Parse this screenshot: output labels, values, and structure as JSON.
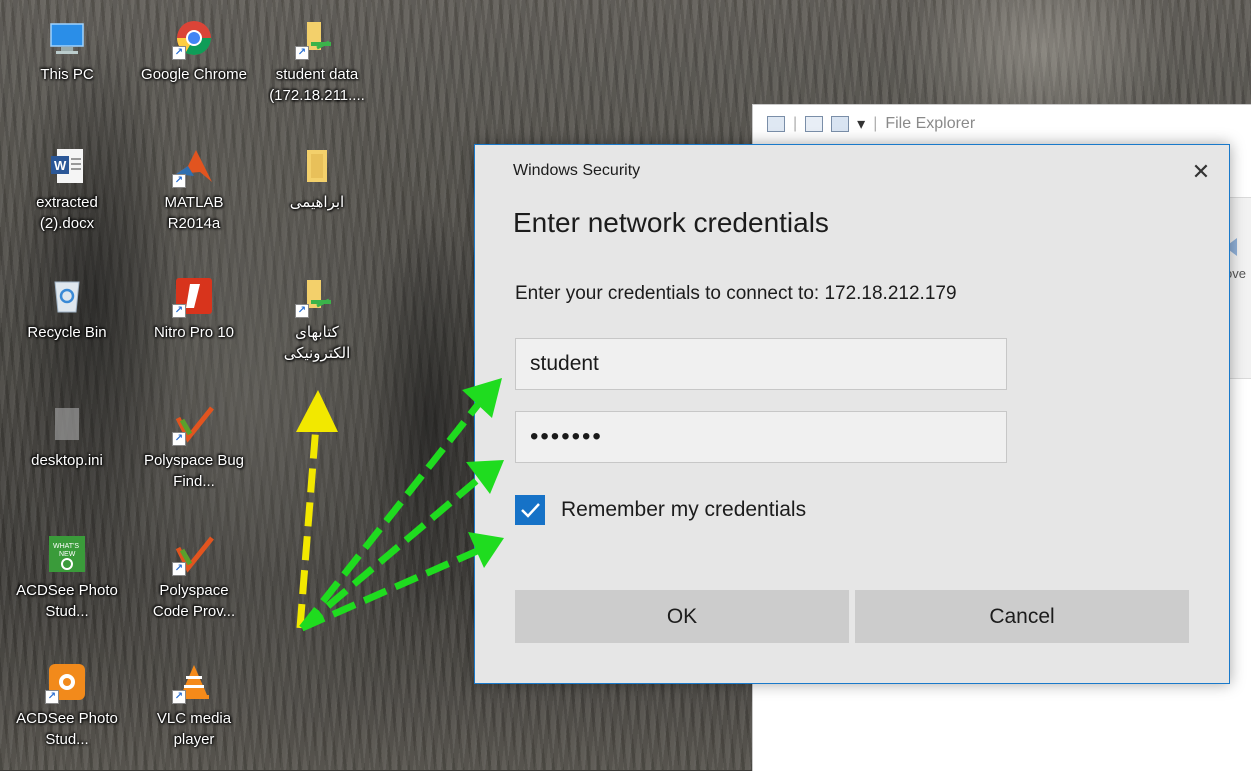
{
  "desktop": {
    "icons": [
      {
        "label": "This PC",
        "icon": "computer-icon"
      },
      {
        "label": "Google Chrome",
        "icon": "chrome-icon"
      },
      {
        "label": "student data (172.18.211....",
        "icon": "network-folder-icon"
      },
      {
        "label": "extracted (2).docx",
        "icon": "word-document-icon"
      },
      {
        "label": "MATLAB R2014a",
        "icon": "matlab-icon"
      },
      {
        "label": "ابراهیمی",
        "icon": "folder-icon"
      },
      {
        "label": "Recycle Bin",
        "icon": "recycle-bin-icon"
      },
      {
        "label": "Nitro Pro 10",
        "icon": "nitro-icon"
      },
      {
        "label": "کتابهای الکترونیکی",
        "icon": "network-folder-icon"
      },
      {
        "label": "desktop.ini",
        "icon": "ini-file-icon"
      },
      {
        "label": "Polyspace Bug Find...",
        "icon": "polyspace-icon"
      },
      {
        "label": "ACDSee Photo Stud...",
        "icon": "acdsee-whats-new-icon"
      },
      {
        "label": "Polyspace Code Prov...",
        "icon": "polyspace-icon"
      },
      {
        "label": "ACDSee Photo Stud...",
        "icon": "acdsee-icon"
      },
      {
        "label": "VLC media player",
        "icon": "vlc-icon"
      }
    ]
  },
  "explorer": {
    "title": "File Explorer",
    "ribbon_fragment": "ove"
  },
  "dialog": {
    "window_title": "Windows Security",
    "heading": "Enter network credentials",
    "prompt": "Enter your credentials to connect to: 172.18.212.179",
    "username_value": "student",
    "password_value": "•••••••",
    "remember_label": "Remember my credentials",
    "remember_checked": true,
    "ok_label": "OK",
    "cancel_label": "Cancel",
    "close_glyph": "✕"
  },
  "annotations": {
    "yellow_arrow_color": "#f2e800",
    "green_arrow_color": "#1fdc1f"
  }
}
